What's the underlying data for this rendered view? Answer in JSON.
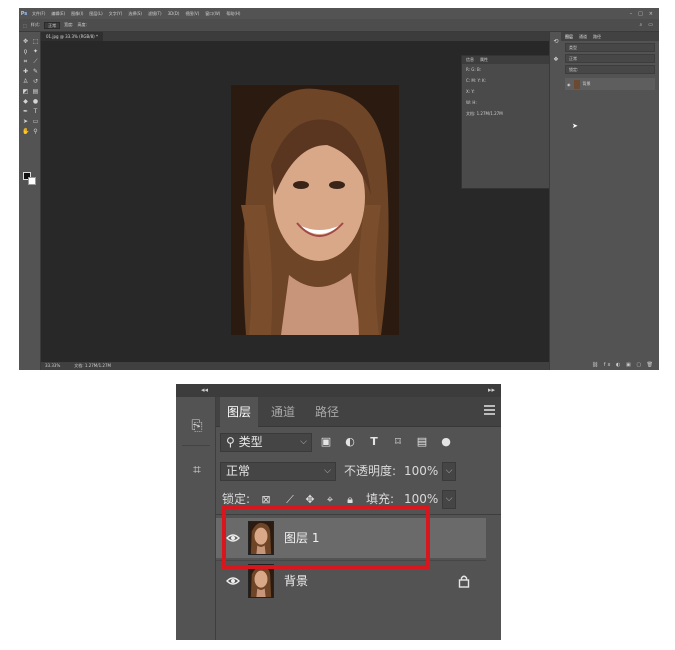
{
  "ps_window": {
    "menu": [
      "文件(F)",
      "编辑(E)",
      "图像(I)",
      "图层(L)",
      "文字(Y)",
      "选择(S)",
      "滤镜(T)",
      "3D(D)",
      "视图(V)",
      "窗口(W)",
      "帮助(H)"
    ],
    "options": [
      "样式:",
      "正常",
      "宽度:",
      "高度:"
    ],
    "doc_tab": "01.jpg @ 33.3% (RGB/8) *",
    "info_panel": {
      "tabs": [
        "信息",
        "属性"
      ],
      "rows": [
        "R: G: B:",
        "C: M: Y: K:",
        "X: Y:",
        "W: H:",
        "文档: 1.27M/1.27M"
      ]
    },
    "status": [
      "33.33%",
      "文档: 1.27M/1.27M"
    ],
    "mini_layers": {
      "tabs": [
        "图层",
        "通道",
        "路径"
      ],
      "rows": [
        "类型",
        "正常",
        "锁定:"
      ],
      "layer_name": "背景"
    }
  },
  "layers_panel": {
    "tabs": [
      "图层",
      "通道",
      "路径"
    ],
    "filter_kind": "类型",
    "blend_mode": "正常",
    "opacity_label": "不透明度:",
    "opacity_value": "100%",
    "lock_label": "锁定:",
    "fill_label": "填充:",
    "fill_value": "100%",
    "layers": [
      {
        "name": "图层 1",
        "visible": true,
        "selected": true
      },
      {
        "name": "背景",
        "visible": true,
        "locked": true
      }
    ],
    "highlight_color": "#d8161e"
  }
}
